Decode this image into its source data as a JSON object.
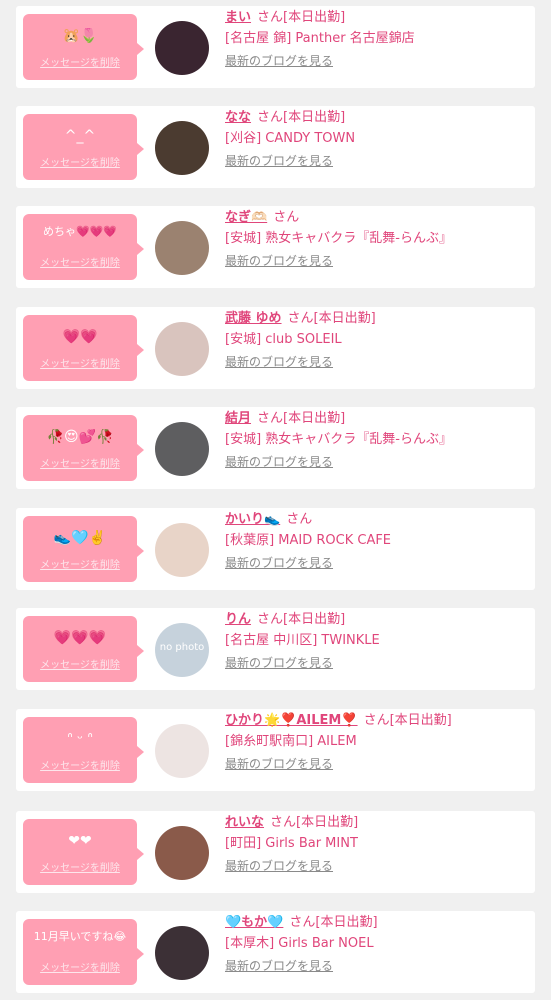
{
  "entries": [
    {
      "message": "🐹🌷",
      "delete_label": "メッセージを削除",
      "name": "まい",
      "honorific": "さん",
      "status": "[本日出勤]",
      "shop": "[名古屋 錦] Panther 名古屋錦店",
      "blog_label": "最新のブログを見る",
      "avatar_color": "#3a2530"
    },
    {
      "message": "^_^",
      "delete_label": "メッセージを削除",
      "name": "なな",
      "honorific": "さん",
      "status": "[本日出勤]",
      "shop": "[刈谷] CANDY TOWN",
      "blog_label": "最新のブログを見る",
      "avatar_color": "#4b3b30"
    },
    {
      "message": "めちゃ💗💗💗",
      "delete_label": "メッセージを削除",
      "name": "なぎ🫶🏻",
      "honorific": "さん",
      "status": "",
      "shop": "[安城] 熟女キャバクラ『乱舞-らんぶ』",
      "blog_label": "最新のブログを見る",
      "avatar_color": "#9b8270"
    },
    {
      "message": "💗💗",
      "delete_label": "メッセージを削除",
      "name": "武藤 ゆめ",
      "honorific": "さん",
      "status": "[本日出勤]",
      "shop": "[安城] club SOLEIL",
      "blog_label": "最新のブログを見る",
      "avatar_color": "#d9c4be"
    },
    {
      "message": "🥀😍💕🥀",
      "delete_label": "メッセージを削除",
      "name": "結月",
      "honorific": "さん",
      "status": "[本日出勤]",
      "shop": "[安城] 熟女キャバクラ『乱舞-らんぶ』",
      "blog_label": "最新のブログを見る",
      "avatar_color": "#5e5e60"
    },
    {
      "message": "👟🩵✌️",
      "delete_label": "メッセージを削除",
      "name": "かいり👟",
      "honorific": "さん",
      "status": "",
      "shop": "[秋葉原] MAID ROCK CAFE",
      "blog_label": "最新のブログを見る",
      "avatar_color": "#e8d4c8"
    },
    {
      "message": "💗💗💗",
      "delete_label": "メッセージを削除",
      "name": "りん",
      "honorific": "さん",
      "status": "[本日出勤]",
      "shop": "[名古屋 中川区] TWINKLE",
      "blog_label": "最新のブログを見る",
      "avatar_color": "#c6d2dc",
      "avatar_text": "no photo"
    },
    {
      "message": "ᐢ ᵕ ᐢ",
      "delete_label": "メッセージを削除",
      "name": "ひかり🌟❣️AILEM❣️",
      "honorific": "さん",
      "status": "[本日出勤]",
      "shop": "[錦糸町駅南口] AILEM",
      "blog_label": "最新のブログを見る",
      "avatar_color": "#ede4e2"
    },
    {
      "message": "❤❤",
      "delete_label": "メッセージを削除",
      "name": "れいな",
      "honorific": "さん",
      "status": "[本日出勤]",
      "shop": "[町田] Girls Bar MINT",
      "blog_label": "最新のブログを見る",
      "avatar_color": "#8a5a4a"
    },
    {
      "message": "11月早いですね😂",
      "delete_label": "メッセージを削除",
      "name": "🩵もか🩵",
      "honorific": "さん",
      "status": "[本日出勤]",
      "shop": "[本厚木] Girls Bar NOEL",
      "blog_label": "最新のブログを見る",
      "avatar_color": "#3c3036"
    }
  ]
}
